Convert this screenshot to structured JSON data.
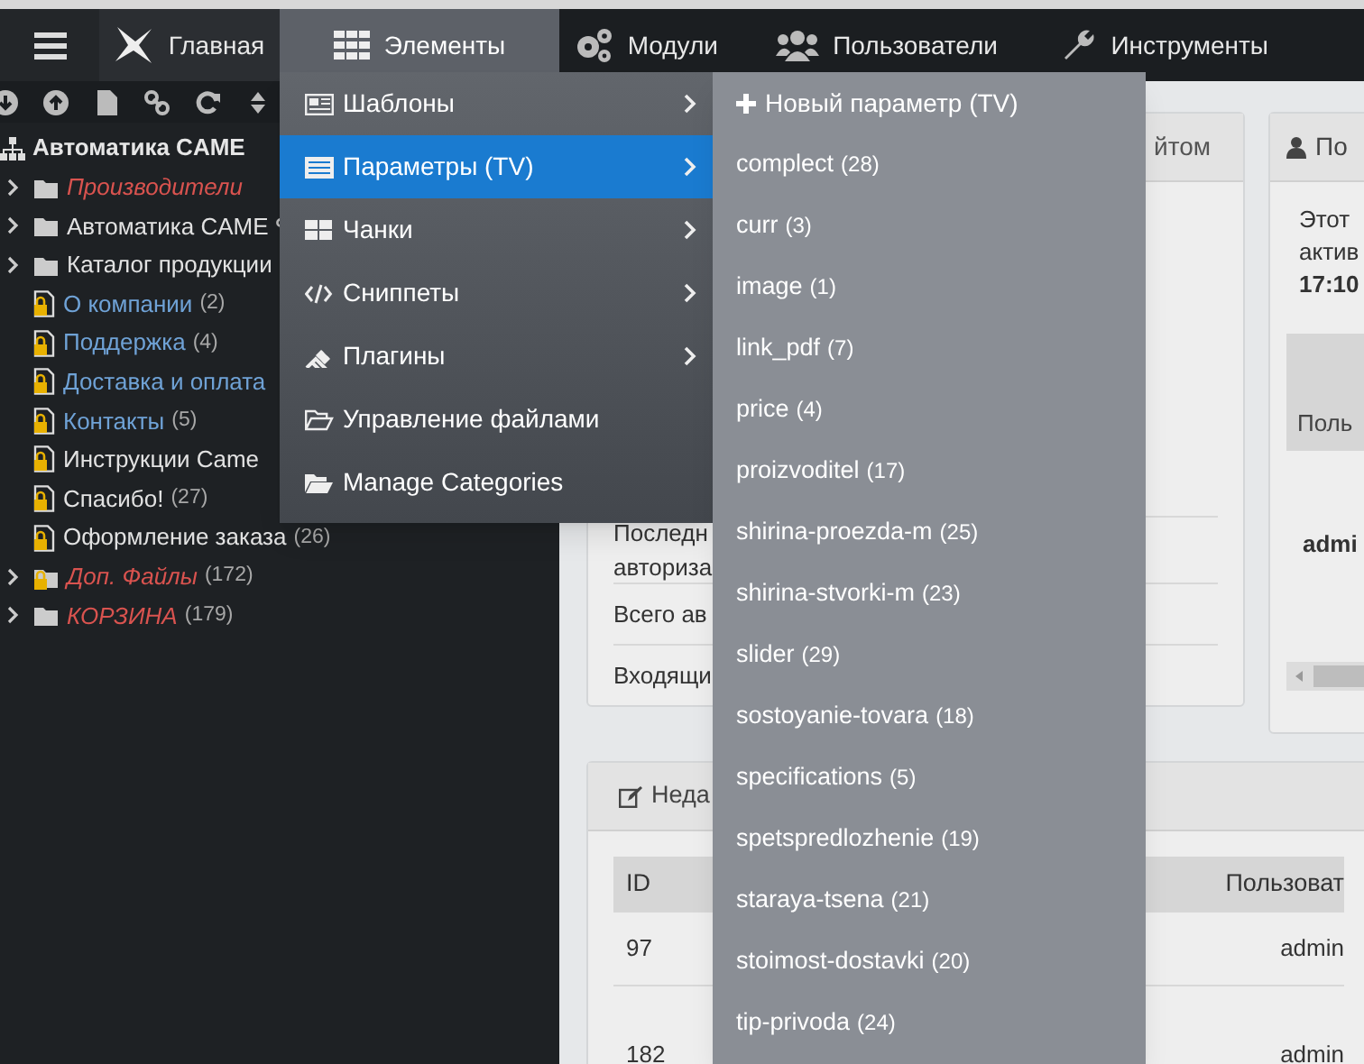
{
  "nav": {
    "items": [
      {
        "label": "Главная",
        "kind": "logo",
        "selected": false
      },
      {
        "label": "Элементы",
        "kind": "grid",
        "selected": true
      },
      {
        "label": "Модули",
        "kind": "gears",
        "selected": false
      },
      {
        "label": "Пользователи",
        "kind": "users",
        "selected": false
      },
      {
        "label": "Инструменты",
        "kind": "wrench",
        "selected": false
      }
    ]
  },
  "tree": {
    "root": "Автоматика CAME",
    "items": [
      {
        "label": "Производители",
        "kind": "folder",
        "unpublished": true,
        "hidden": false,
        "locked": false,
        "expanded": false
      },
      {
        "label": "Автоматика CAME",
        "kind": "folder",
        "unpublished": false,
        "hidden": false,
        "locked": false,
        "expanded": false,
        "linked": true
      },
      {
        "label": "Каталог продукции",
        "kind": "folder",
        "unpublished": false,
        "hidden": false,
        "locked": false,
        "expanded": false
      },
      {
        "label": "О компании",
        "count": "(2)",
        "kind": "page",
        "unpublished": false,
        "hidden": true,
        "locked": true
      },
      {
        "label": "Поддержка",
        "count": "(4)",
        "kind": "page",
        "unpublished": false,
        "hidden": true,
        "locked": true
      },
      {
        "label": "Доставка и оплата",
        "kind": "page",
        "unpublished": false,
        "hidden": true,
        "locked": true
      },
      {
        "label": "Контакты",
        "count": "(5)",
        "kind": "page",
        "unpublished": false,
        "hidden": true,
        "locked": true
      },
      {
        "label": "Инструкции Came",
        "kind": "page",
        "unpublished": false,
        "hidden": false,
        "locked": true
      },
      {
        "label": "Спасибо!",
        "count": "(27)",
        "kind": "page",
        "unpublished": false,
        "hidden": false,
        "locked": true
      },
      {
        "label": "Оформление заказа",
        "count": "(26)",
        "kind": "page",
        "unpublished": false,
        "hidden": false,
        "locked": true
      },
      {
        "label": "Доп. Файлы",
        "count": "(172)",
        "kind": "folder",
        "unpublished": true,
        "hidden": false,
        "locked": true,
        "expanded": false
      },
      {
        "label": "КОРЗИНА",
        "count": "(179)",
        "kind": "folder",
        "unpublished": true,
        "hidden": false,
        "locked": false,
        "expanded": false
      }
    ]
  },
  "elements_menu": {
    "items": [
      {
        "label": "Шаблоны",
        "kind": "templates",
        "has_submenu": true,
        "selected": false
      },
      {
        "label": "Параметры (TV)",
        "kind": "tvs",
        "has_submenu": true,
        "selected": true
      },
      {
        "label": "Чанки",
        "kind": "chunks",
        "has_submenu": true,
        "selected": false
      },
      {
        "label": "Сниппеты",
        "kind": "snippets",
        "has_submenu": true,
        "selected": false
      },
      {
        "label": "Плагины",
        "kind": "plugins",
        "has_submenu": true,
        "selected": false
      },
      {
        "label": "Управление файлами",
        "kind": "files",
        "has_submenu": false,
        "selected": false
      },
      {
        "label": "Manage Categories",
        "kind": "categories",
        "has_submenu": false,
        "selected": false
      }
    ]
  },
  "tv_submenu": {
    "new_item": "Новый параметр (TV)",
    "items": [
      {
        "name": "complect",
        "count": "(28)"
      },
      {
        "name": "curr",
        "count": "(3)"
      },
      {
        "name": "image",
        "count": "(1)"
      },
      {
        "name": "link_pdf",
        "count": "(7)"
      },
      {
        "name": "price",
        "count": "(4)"
      },
      {
        "name": "proizvoditel",
        "count": "(17)"
      },
      {
        "name": "shirina-proezda-m",
        "count": "(25)"
      },
      {
        "name": "shirina-stvorki-m",
        "count": "(23)"
      },
      {
        "name": "slider",
        "count": "(29)"
      },
      {
        "name": "sostoyanie-tovara",
        "count": "(18)"
      },
      {
        "name": "specifications",
        "count": "(5)"
      },
      {
        "name": "spetspredlozhenie",
        "count": "(19)"
      },
      {
        "name": "staraya-tsena",
        "count": "(21)"
      },
      {
        "name": "stoimost-dostavki",
        "count": "(20)"
      },
      {
        "name": "tip-privoda",
        "count": "(24)"
      }
    ]
  },
  "welcome_card": {
    "title": "йтом",
    "rows": [
      [
        "Последн",
        "авториза"
      ],
      [
        "Всего ав"
      ],
      [
        "Входящи"
      ]
    ]
  },
  "user_card": {
    "title": "По",
    "lines": [
      "Этот",
      "актив"
    ],
    "time": "17:10",
    "table_header": "Поль",
    "user": "admi"
  },
  "recent_card": {
    "title": "Неда",
    "columns": [
      "ID",
      "Пользоват"
    ],
    "rows": [
      [
        "97",
        "admin"
      ],
      [
        "182",
        "admin"
      ]
    ]
  }
}
